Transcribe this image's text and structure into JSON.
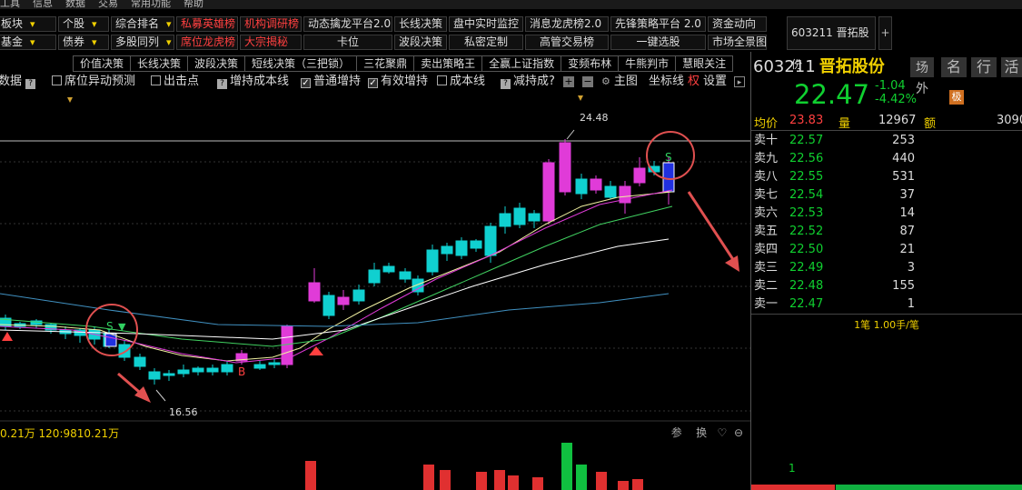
{
  "menubar": [
    "工具",
    "信息",
    "数据",
    "交易",
    "常用功能",
    "帮助"
  ],
  "row1": [
    {
      "label": "板块",
      "style": "dd"
    },
    {
      "label": "个股",
      "style": "dd"
    },
    {
      "label": "综合排名",
      "style": "dd"
    },
    {
      "label": "私募英雄榜",
      "style": "red"
    },
    {
      "label": "机构调研榜",
      "style": "red"
    },
    {
      "label": "动态擒龙平台2.0",
      "style": ""
    },
    {
      "label": "长线决策",
      "style": ""
    },
    {
      "label": "盘中实时监控",
      "style": ""
    },
    {
      "label": "消息龙虎榜2.0",
      "style": ""
    },
    {
      "label": "先锋策略平台 2.0",
      "style": ""
    },
    {
      "label": "资金动向",
      "style": ""
    }
  ],
  "row2": [
    {
      "label": "基金",
      "style": "dd"
    },
    {
      "label": "债券",
      "style": "dd"
    },
    {
      "label": "多股同列",
      "style": "dd"
    },
    {
      "label": "席位龙虎榜",
      "style": "red"
    },
    {
      "label": "大宗揭秘",
      "style": "red"
    },
    {
      "label": "卡位",
      "style": ""
    },
    {
      "label": "波段决策",
      "style": ""
    },
    {
      "label": "私密定制",
      "style": ""
    },
    {
      "label": "高管交易榜",
      "style": ""
    },
    {
      "label": "一键选股",
      "style": ""
    },
    {
      "label": "市场全景图",
      "style": ""
    }
  ],
  "side_code": "603211 晋拓股份",
  "plus": "+",
  "tabs": [
    "价值决策",
    "长线决策",
    "波段决策",
    "短线决策（三把锁）",
    "三花聚鼎",
    "卖出策略王",
    "全赢上证指数",
    "变频布林",
    "牛熊判市",
    "慧眼关注"
  ],
  "toolbar": {
    "shuju": "数据",
    "q": "?",
    "xiwei": "席位异动预测",
    "chuchudian": "出击点",
    "zengchi": "增持成本线",
    "putong": "普通增持",
    "youxiao": "有效增持",
    "chengben": "成本线",
    "jianchi": "减持成?",
    "zhutu": "主图",
    "zuobiao": "坐标线",
    "quan": "权",
    "shezhi": "设置",
    "plus": "+",
    "minus": "−",
    "more": "▸"
  },
  "chart_data": {
    "type": "candlestick",
    "price_axis_visible_labels": [
      "24.48",
      "16.56"
    ],
    "high_label": "24.48",
    "low_label": "16.56",
    "markers": [
      {
        "text": "S",
        "color": "#30d060"
      },
      {
        "text": "▼",
        "color": "#30d060"
      },
      {
        "text": "B",
        "color": "#ff4040"
      },
      {
        "text": "S",
        "color": "#30d060"
      }
    ]
  },
  "indicator": {
    "values": "0.21万  120:9810.21万",
    "tools": [
      "参",
      "换",
      "♡",
      "⊖"
    ]
  },
  "stock": {
    "code": "603211",
    "name": "晋拓股份",
    "tabs": [
      "场外",
      "名",
      "行",
      "活"
    ],
    "price": "22.47",
    "change": "-1.04",
    "pct": "-4.42%",
    "badge": "极"
  },
  "quote": {
    "avg_label": "均价",
    "avg": "23.83",
    "vol_label": "量",
    "vol": "12967",
    "amt_label": "额",
    "amt": "3090"
  },
  "orders": [
    {
      "label": "卖十",
      "price": "22.57",
      "vol": "253"
    },
    {
      "label": "卖九",
      "price": "22.56",
      "vol": "440"
    },
    {
      "label": "卖八",
      "price": "22.55",
      "vol": "531"
    },
    {
      "label": "卖七",
      "price": "22.54",
      "vol": "37"
    },
    {
      "label": "卖六",
      "price": "22.53",
      "vol": "14"
    },
    {
      "label": "卖五",
      "price": "22.52",
      "vol": "87"
    },
    {
      "label": "卖四",
      "price": "22.50",
      "vol": "21"
    },
    {
      "label": "卖三",
      "price": "22.49",
      "vol": "3"
    },
    {
      "label": "卖二",
      "price": "22.48",
      "vol": "155"
    },
    {
      "label": "卖一",
      "price": "22.47",
      "vol": "1"
    }
  ],
  "bifoot": "1笔 1.00手/笔",
  "bottom": {
    "num": "1",
    "red_pct": "29%",
    "green_pct": "71%"
  },
  "colors": {
    "up": "#e03bd8",
    "down": "#10d0d0",
    "red": "#ff4040",
    "green": "#10d030",
    "yellow": "#f0d000"
  }
}
